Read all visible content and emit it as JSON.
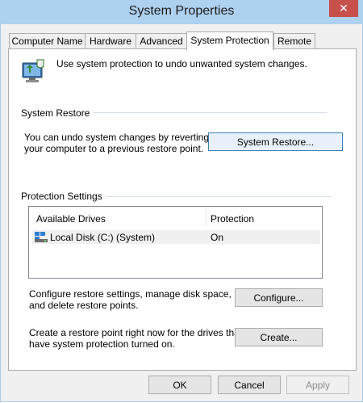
{
  "window": {
    "title": "System Properties",
    "close_label": "✕"
  },
  "tabs": [
    {
      "label": "Computer Name"
    },
    {
      "label": "Hardware"
    },
    {
      "label": "Advanced"
    },
    {
      "label": "System Protection"
    },
    {
      "label": "Remote"
    }
  ],
  "intro_text": "Use system protection to undo unwanted system changes.",
  "system_restore": {
    "group_label": "System Restore",
    "description_line1": "You can undo system changes by reverting",
    "description_line2": "your computer to a previous restore point.",
    "button_label": "System Restore..."
  },
  "protection_settings": {
    "group_label": "Protection Settings",
    "columns": [
      "Available Drives",
      "Protection"
    ],
    "rows": [
      {
        "drive": "Local Disk (C:) (System)",
        "protection": "On"
      }
    ],
    "configure_text_line1": "Configure restore settings, manage disk space,",
    "configure_text_line2": "and delete restore points.",
    "configure_button": "Configure...",
    "create_text_line1": "Create a restore point right now for the drives that",
    "create_text_line2": "have system protection turned on.",
    "create_button": "Create..."
  },
  "footer": {
    "ok": "OK",
    "cancel": "Cancel",
    "apply": "Apply"
  },
  "colors": {
    "titlebar": "#aed1f0",
    "close": "#c7504a",
    "accent": "#3c7fb1"
  }
}
